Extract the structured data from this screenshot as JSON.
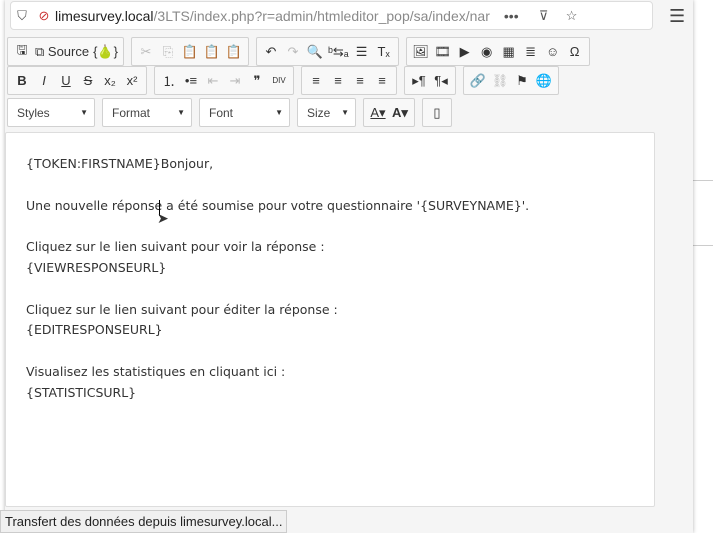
{
  "browser": {
    "url_host": "limesurvey.local",
    "url_path": "/3LTS/index.php?r=admin/htmleditor_pop/sa/index/nar",
    "more": "•••"
  },
  "toolbar": {
    "row1": [
      [
        {
          "n": "save",
          "g": "🖫"
        },
        {
          "n": "source",
          "g": "⧉ Source"
        },
        {
          "n": "templates",
          "g": "{🍐}"
        }
      ],
      [
        {
          "n": "cut",
          "g": "✂",
          "d": 1
        },
        {
          "n": "copy",
          "g": "⎘",
          "d": 1
        },
        {
          "n": "paste",
          "g": "📋"
        },
        {
          "n": "paste-text",
          "g": "📋"
        },
        {
          "n": "paste-word",
          "g": "📋"
        }
      ],
      [
        {
          "n": "undo",
          "g": "↶"
        },
        {
          "n": "redo",
          "g": "↷",
          "d": 1
        },
        {
          "n": "find",
          "g": "🔍"
        },
        {
          "n": "replace",
          "g": "ᵇ⇆ₐ"
        },
        {
          "n": "select-all",
          "g": "☰"
        },
        {
          "n": "remove-format",
          "g": "Tₓ"
        }
      ],
      [
        {
          "n": "image",
          "g": "🖼"
        },
        {
          "n": "flash",
          "g": "🎞"
        },
        {
          "n": "video",
          "g": "▶"
        },
        {
          "n": "iframe",
          "g": "◉"
        },
        {
          "n": "table",
          "g": "▦"
        },
        {
          "n": "horizontal-rule",
          "g": "≣"
        },
        {
          "n": "smiley",
          "g": "☺"
        },
        {
          "n": "special-char",
          "g": "Ω"
        }
      ]
    ],
    "row2": [
      [
        {
          "n": "bold",
          "g": "B"
        },
        {
          "n": "italic",
          "g": "I"
        },
        {
          "n": "underline",
          "g": "U"
        },
        {
          "n": "strike",
          "g": "S"
        },
        {
          "n": "subscript",
          "g": "x₂"
        },
        {
          "n": "superscript",
          "g": "x²"
        }
      ],
      [
        {
          "n": "numbered-list",
          "g": "⒈"
        },
        {
          "n": "bulleted-list",
          "g": "•≡"
        },
        {
          "n": "outdent",
          "g": "⇤",
          "d": 1
        },
        {
          "n": "indent",
          "g": "⇥",
          "d": 1
        },
        {
          "n": "blockquote",
          "g": "❞"
        },
        {
          "n": "div",
          "g": "DIV"
        }
      ],
      [
        {
          "n": "align-left",
          "g": "≡"
        },
        {
          "n": "align-center",
          "g": "≡"
        },
        {
          "n": "align-right",
          "g": "≡"
        },
        {
          "n": "justify",
          "g": "≡"
        }
      ],
      [
        {
          "n": "ltr",
          "g": "▸¶"
        },
        {
          "n": "rtl",
          "g": "¶◂"
        }
      ],
      [
        {
          "n": "link",
          "g": "🔗"
        },
        {
          "n": "unlink",
          "g": "⛓",
          "d": 1
        },
        {
          "n": "anchor",
          "g": "⚑"
        },
        {
          "n": "language",
          "g": "🌐"
        }
      ]
    ],
    "combos": [
      "Styles",
      "Format",
      "Font",
      "Size"
    ],
    "text_color": "A▾",
    "bg_color": "A▾",
    "show_blocks": "▯"
  },
  "editor": {
    "lines": [
      "{TOKEN:FIRSTNAME}Bonjour,",
      "Une nouvelle réponse a été soumise pour votre questionnaire '{SURVEYNAME}'.",
      "Cliquez sur le lien suivant pour voir la réponse :",
      "{VIEWRESPONSEURL}",
      "Cliquez sur le lien suivant pour éditer la réponse :",
      "{EDITRESPONSEURL}",
      "Visualisez les statistiques en cliquant ici :",
      "{STATISTICSURL}"
    ]
  },
  "status": "Transfert des données depuis limesurvey.local..."
}
